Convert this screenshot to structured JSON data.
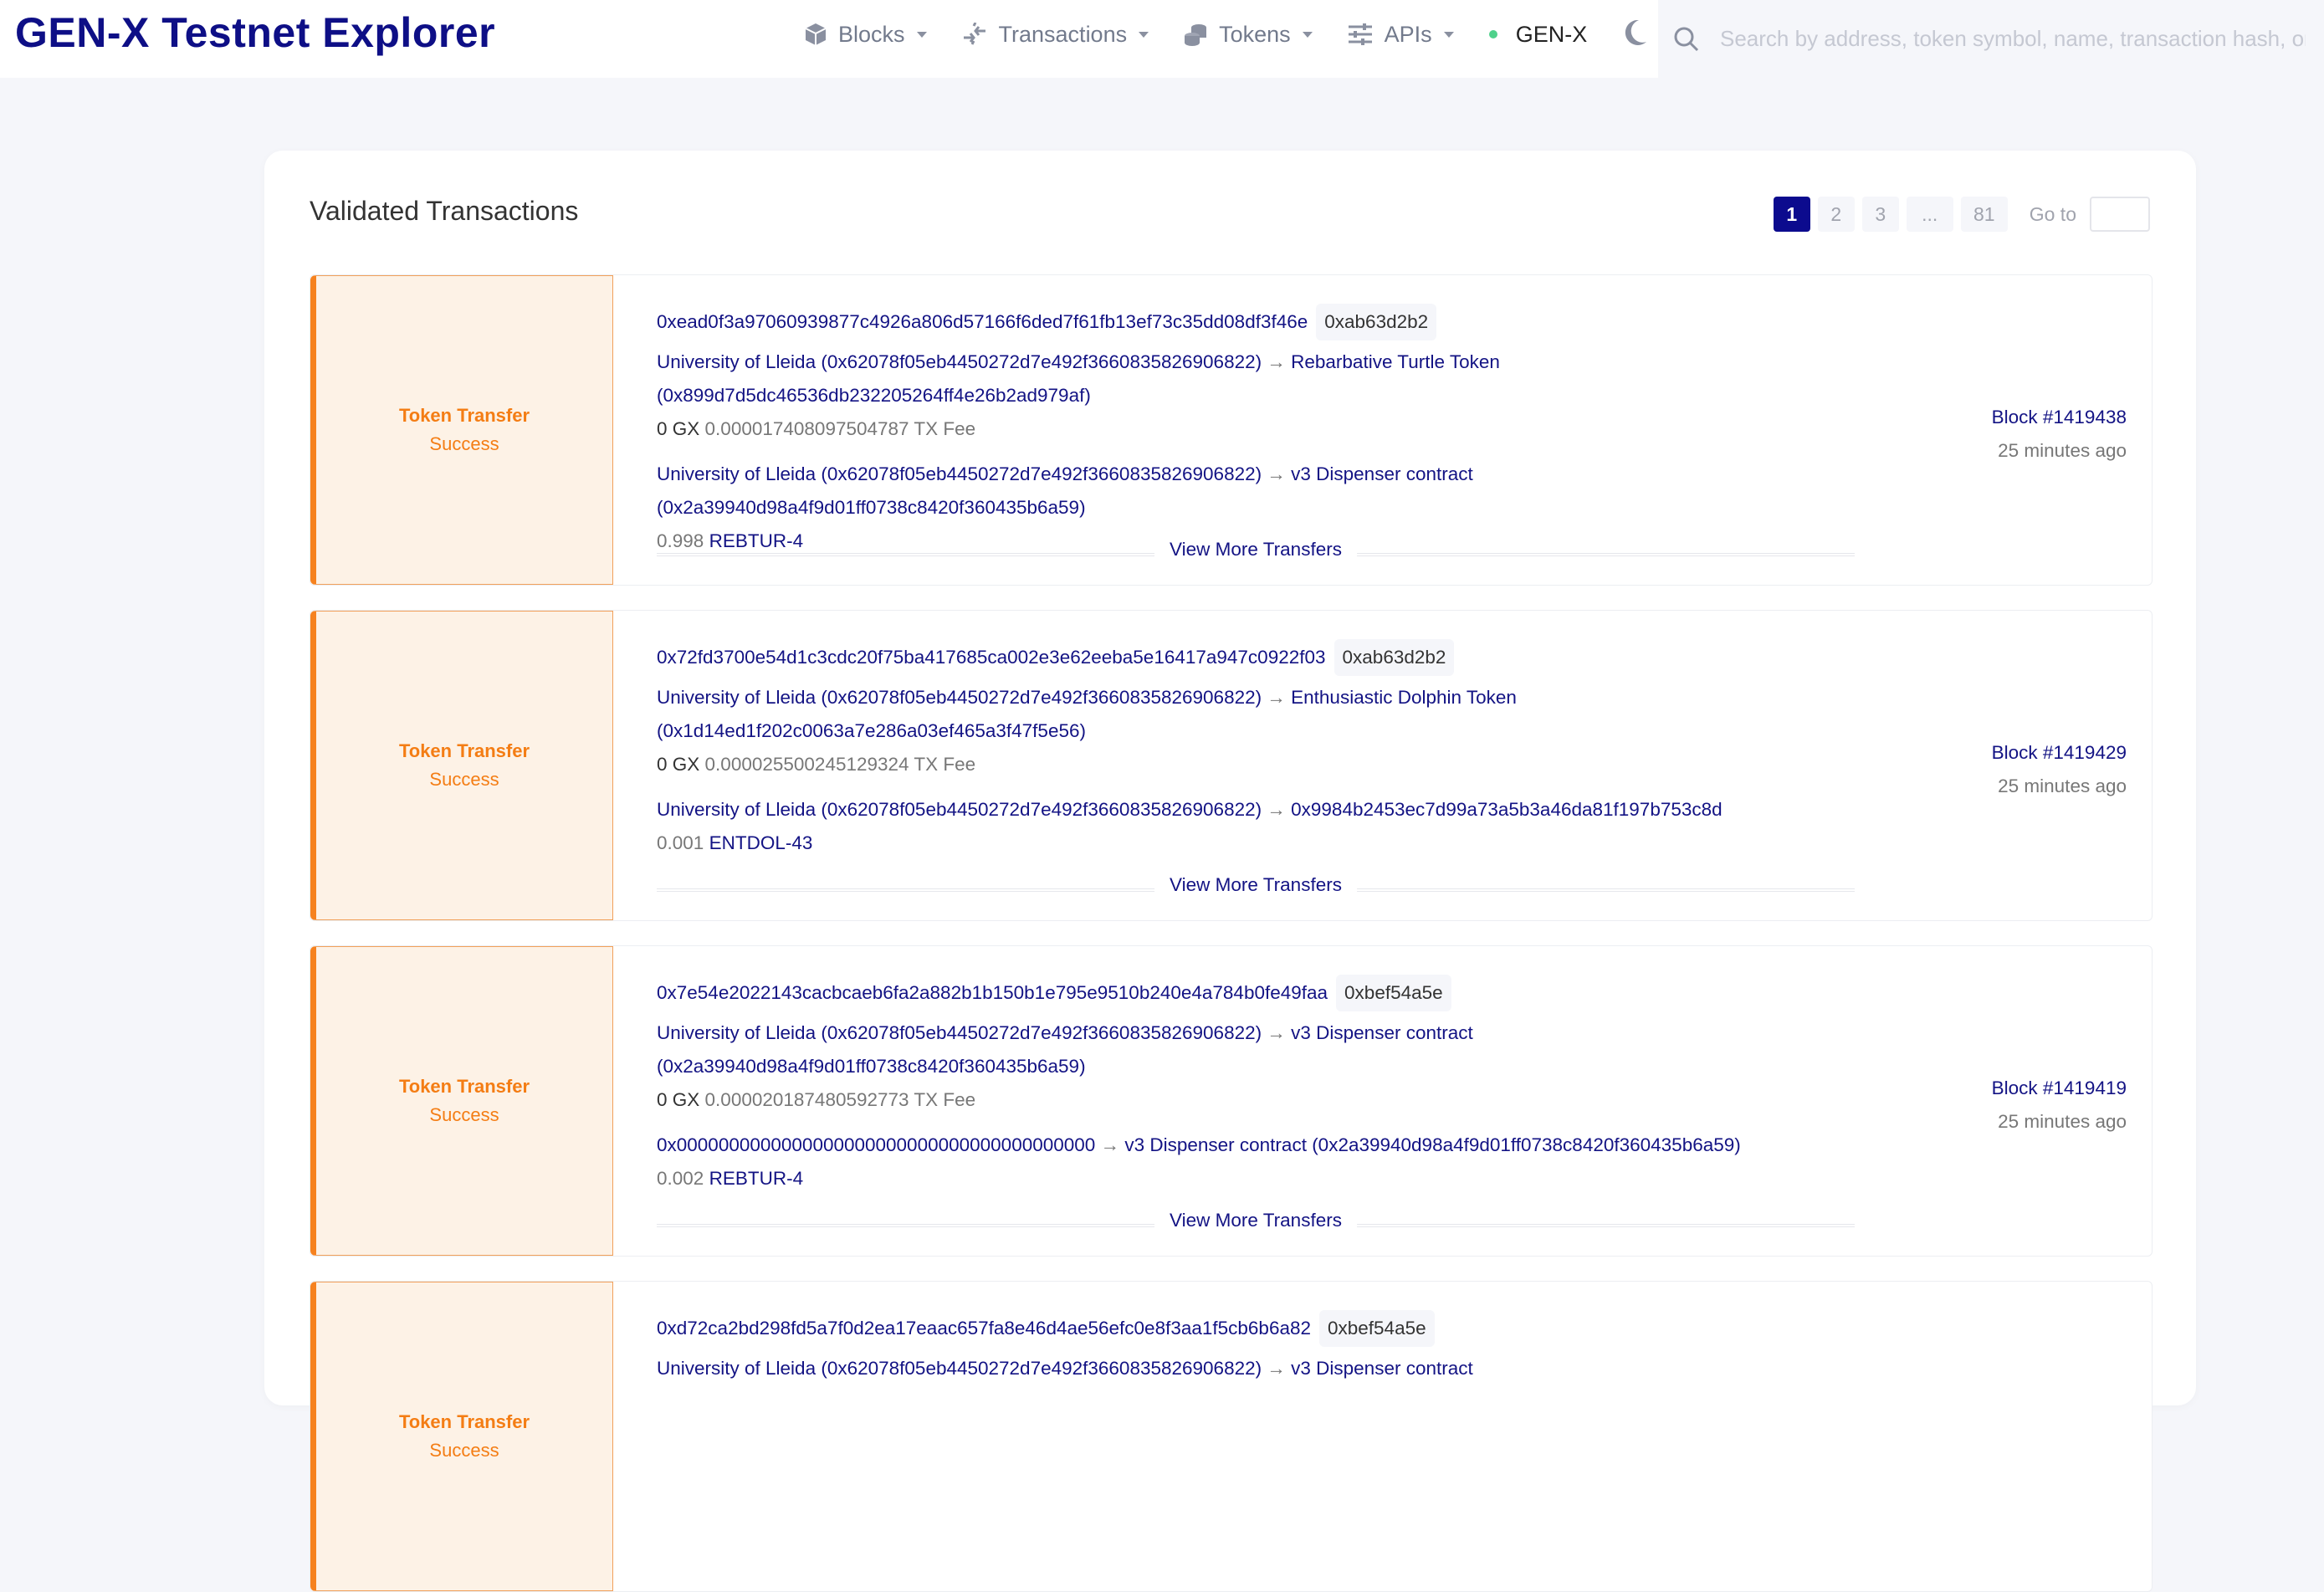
{
  "header": {
    "title": "GEN-X Testnet Explorer",
    "nav": [
      {
        "label": "Blocks",
        "icon": "cube-icon"
      },
      {
        "label": "Transactions",
        "icon": "transactions-icon"
      },
      {
        "label": "Tokens",
        "icon": "coins-icon"
      },
      {
        "label": "APIs",
        "icon": "sliders-icon"
      }
    ],
    "network": "GEN-X",
    "network_status_color": "#4fd18b",
    "search_placeholder": "Search by address, token symbol, name, transaction hash, or block number"
  },
  "main": {
    "title": "Validated Transactions",
    "pagination": {
      "pages": [
        "1",
        "2",
        "3",
        "...",
        "81"
      ],
      "active": "1",
      "goto_label": "Go to",
      "goto_value": ""
    },
    "transactions": [
      {
        "type": "Token Transfer",
        "status": "Success",
        "hash": "0xead0f3a97060939877c4926a806d57166f6ded7f61fb13ef73c35dd08df3f46e",
        "method": "0xab63d2b2",
        "head_from": "University of Lleida (0x62078f05eb4450272d7e492f3660835826906822)",
        "head_to_name": "Rebarbative Turtle Token",
        "head_to_addr": "(0x899d7d5dc46536db232205264ff4e26b2ad979af)",
        "value": "0 GX",
        "fee": "0.000017408097504787 TX Fee",
        "transfer_from": "University of Lleida (0x62078f05eb4450272d7e492f3660835826906822)",
        "transfer_to": "v3 Dispenser contract (0x2a39940d98a4f9d01ff0738c8420f360435b6a59)",
        "amount": "0.998",
        "token": "REBTUR-4",
        "more": "View More Transfers",
        "block": "Block #1419438",
        "age": "25 minutes ago"
      },
      {
        "type": "Token Transfer",
        "status": "Success",
        "hash": "0x72fd3700e54d1c3cdc20f75ba417685ca002e3e62eeba5e16417a947c0922f03",
        "method": "0xab63d2b2",
        "head_from": "University of Lleida (0x62078f05eb4450272d7e492f3660835826906822)",
        "head_to_name": "Enthusiastic Dolphin Token",
        "head_to_addr": "(0x1d14ed1f202c0063a7e286a03ef465a3f47f5e56)",
        "value": "0 GX",
        "fee": "0.000025500245129324 TX Fee",
        "transfer_from": "University of Lleida (0x62078f05eb4450272d7e492f3660835826906822)",
        "transfer_to": "0x9984b2453ec7d99a73a5b3a46da81f197b753c8d",
        "amount": "0.001",
        "token": "ENTDOL-43",
        "more": "View More Transfers",
        "block": "Block #1419429",
        "age": "25 minutes ago"
      },
      {
        "type": "Token Transfer",
        "status": "Success",
        "hash": "0x7e54e2022143cacbcaeb6fa2a882b1b150b1e795e9510b240e4a784b0fe49faa",
        "method": "0xbef54a5e",
        "head_from": "University of Lleida (0x62078f05eb4450272d7e492f3660835826906822)",
        "head_to_name": "v3 Dispenser contract",
        "head_to_addr": "(0x2a39940d98a4f9d01ff0738c8420f360435b6a59)",
        "value": "0 GX",
        "fee": "0.000020187480592773 TX Fee",
        "transfer_from": "0x0000000000000000000000000000000000000000",
        "transfer_to": "v3 Dispenser contract (0x2a39940d98a4f9d01ff0738c8420f360435b6a59)",
        "amount": "0.002",
        "token": "REBTUR-4",
        "more": "View More Transfers",
        "block": "Block #1419419",
        "age": "25 minutes ago"
      },
      {
        "type": "Token Transfer",
        "status": "Success",
        "hash": "0xd72ca2bd298fd5a7f0d2ea17eaac657fa8e46d4ae56efc0e8f3aa1f5cb6b6a82",
        "method": "0xbef54a5e",
        "head_from": "University of Lleida (0x62078f05eb4450272d7e492f3660835826906822)",
        "head_to_name": "v3 Dispenser contract"
      }
    ],
    "arrow": "→"
  },
  "colors": {
    "brand": "#0e0f86",
    "link": "#131384",
    "accent_orange": "#f6821f",
    "tile_bg": "#fdf2e6",
    "active_page": "#0c0b8e"
  }
}
